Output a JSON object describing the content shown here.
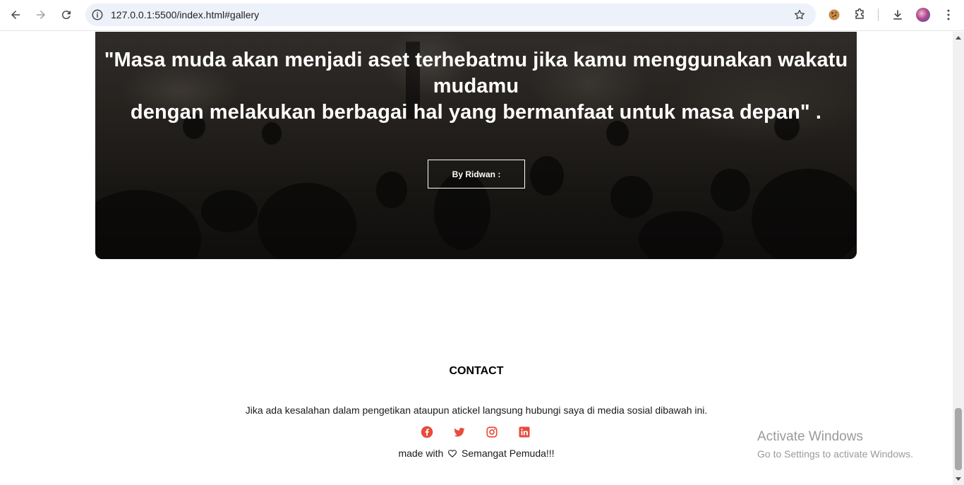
{
  "browser": {
    "url": "127.0.0.1:5500/index.html#gallery",
    "icons": [
      "back-icon",
      "forward-icon",
      "reload-icon",
      "site-info-icon",
      "bookmark-star-icon",
      "cookie-extension-icon",
      "extensions-puzzle-icon",
      "download-icon",
      "profile-avatar",
      "more-menu-icon"
    ]
  },
  "hero": {
    "quote_line1": "\"Masa muda akan menjadi aset terhebatmu jika kamu menggunakan wakatu",
    "quote_line2": "mudamu",
    "quote_line3": "dengan melakukan berbagai hal yang bermanfaat untuk masa depan\" .",
    "author_label": "By Ridwan :"
  },
  "contact": {
    "title": "CONTACT",
    "text": "Jika ada kesalahan dalam pengetikan ataupun atickel langsung hubungi saya di media sosial dibawah ini.",
    "socials": [
      "facebook-icon",
      "twitter-icon",
      "instagram-icon",
      "linkedin-icon"
    ],
    "social_color": "#e74c3c",
    "made_prefix": "made with",
    "made_suffix": "Semangat Pemuda!!!"
  },
  "watermark": {
    "title": "Activate Windows",
    "subtitle": "Go to Settings to activate Windows."
  }
}
